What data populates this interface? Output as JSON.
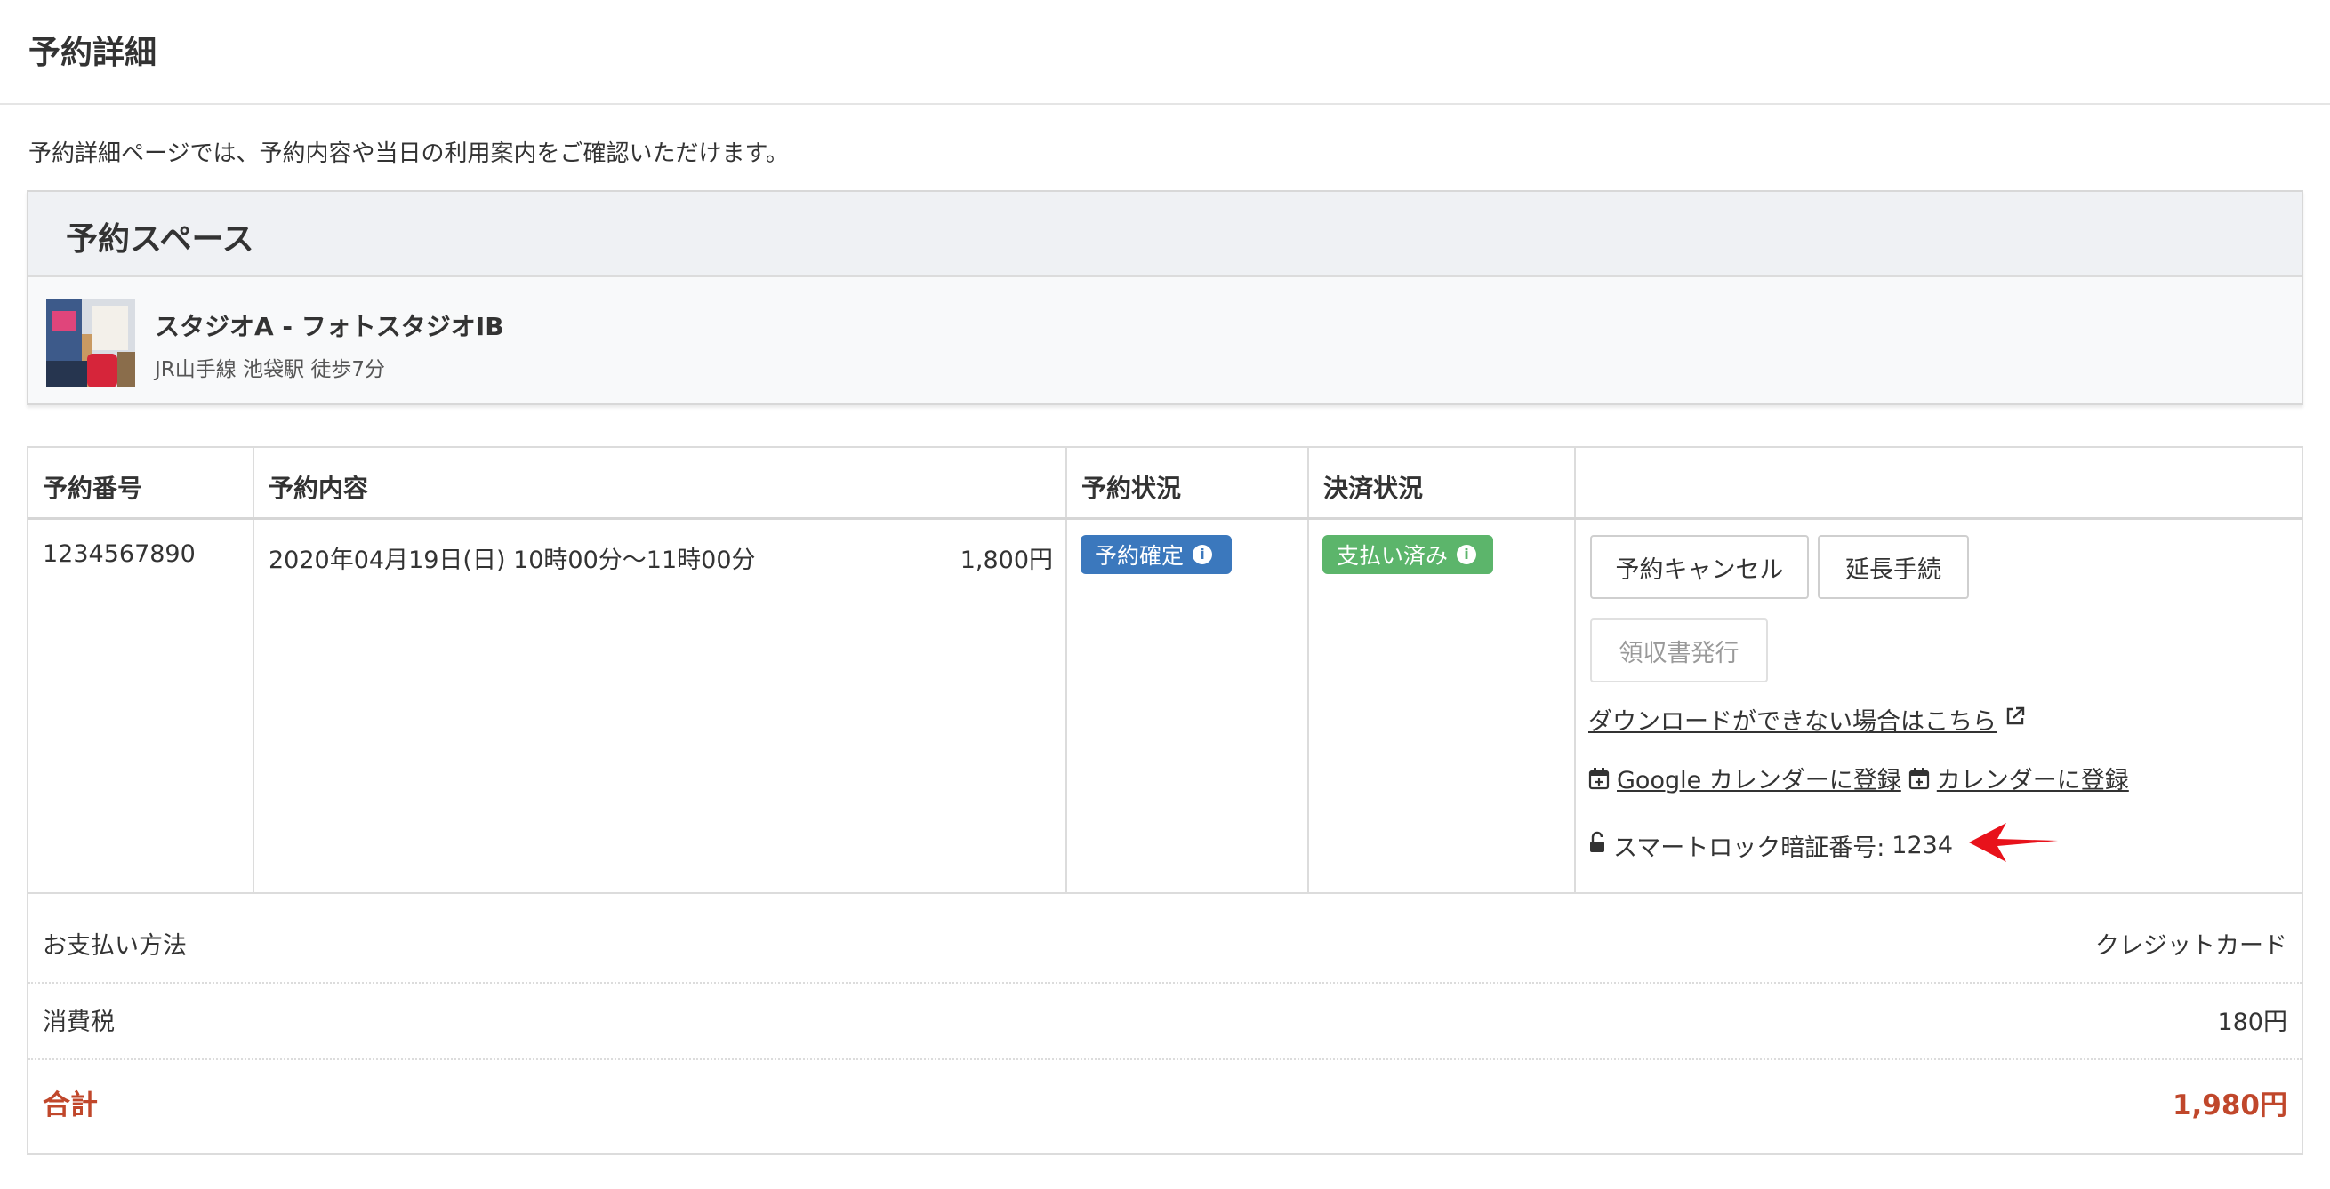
{
  "header": {
    "title": "予約詳細"
  },
  "description": "予約詳細ページでは、予約内容や当日の利用案内をご確認いただけます。",
  "space": {
    "section_title": "予約スペース",
    "name": "スタジオA - フォトスタジオIB",
    "access": "JR山手線 池袋駅 徒歩7分"
  },
  "table": {
    "headers": {
      "number": "予約番号",
      "content": "予約内容",
      "status": "予約状況",
      "payment": "決済状況"
    },
    "row": {
      "number": "1234567890",
      "datetime": "2020年04月19日(日) 10時00分〜11時00分",
      "price": "1,800円",
      "status_badge": "予約確定",
      "payment_badge": "支払い済み"
    },
    "actions": {
      "cancel_button": "予約キャンセル",
      "extend_button": "延長手続",
      "receipt_button": "領収書発行",
      "download_help_link": "ダウンロードができない場合はこちら",
      "google_calendar_link": "Google カレンダーに登録",
      "calendar_link": "カレンダーに登録",
      "smart_lock_label": "スマートロック暗証番号:",
      "smart_lock_code": "1234"
    }
  },
  "summary": {
    "payment_method_label": "お支払い方法",
    "payment_method_value": "クレジットカード",
    "tax_label": "消費税",
    "tax_value": "180円",
    "total_label": "合計",
    "total_value": "1,980円"
  },
  "colors": {
    "status_confirmed": "#3b78bd",
    "payment_paid": "#5cb56b",
    "total_text": "#c0472b",
    "annotation_arrow": "#e8121b"
  },
  "icons": {
    "info": "info-circle-icon",
    "external": "external-link-icon",
    "calendar": "calendar-plus-icon",
    "lock": "unlock-icon",
    "arrow": "red-arrow-icon"
  }
}
